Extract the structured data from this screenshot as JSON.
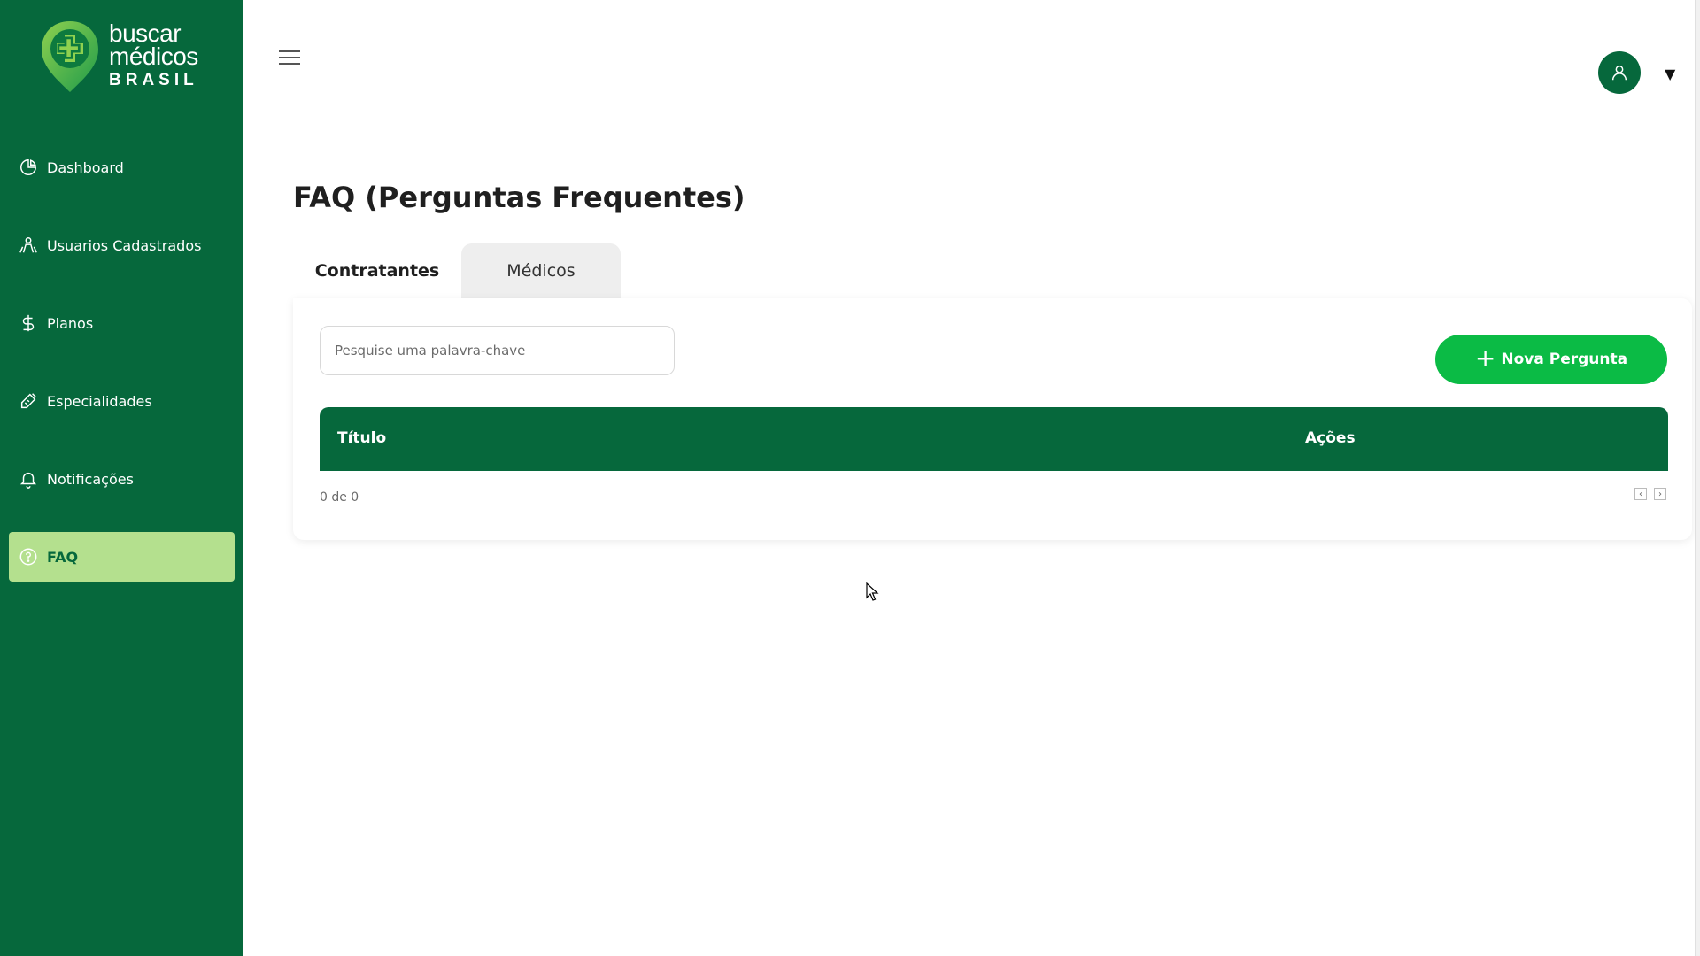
{
  "brand": {
    "line1": "buscar",
    "line2": "médicos",
    "line3": "BRASIL",
    "primary_color": "#06683c",
    "accent_color": "#b4e08e",
    "button_color": "#0bbb45"
  },
  "sidebar": {
    "items": [
      {
        "label": "Dashboard",
        "icon": "pie-chart-icon"
      },
      {
        "label": "Usuarios Cadastrados",
        "icon": "users-icon"
      },
      {
        "label": "Planos",
        "icon": "dollar-icon"
      },
      {
        "label": "Especialidades",
        "icon": "syringe-icon"
      },
      {
        "label": "Notificações",
        "icon": "bell-icon"
      },
      {
        "label": "FAQ",
        "icon": "help-circle-icon",
        "active": true
      }
    ]
  },
  "header": {
    "menu_icon": "hamburger-menu-icon",
    "user_icon": "user-icon",
    "caret": "▼"
  },
  "main": {
    "title": "FAQ (Perguntas Frequentes)",
    "tabs": [
      {
        "label": "Contratantes",
        "active": true
      },
      {
        "label": "Médicos",
        "active": false
      }
    ],
    "search": {
      "placeholder": "Pesquise uma palavra-chave",
      "value": ""
    },
    "new_button": "Nova Pergunta",
    "table": {
      "columns": [
        "Título",
        "Ações"
      ],
      "rows": []
    },
    "pagination": {
      "summary": "0 de 0"
    }
  }
}
